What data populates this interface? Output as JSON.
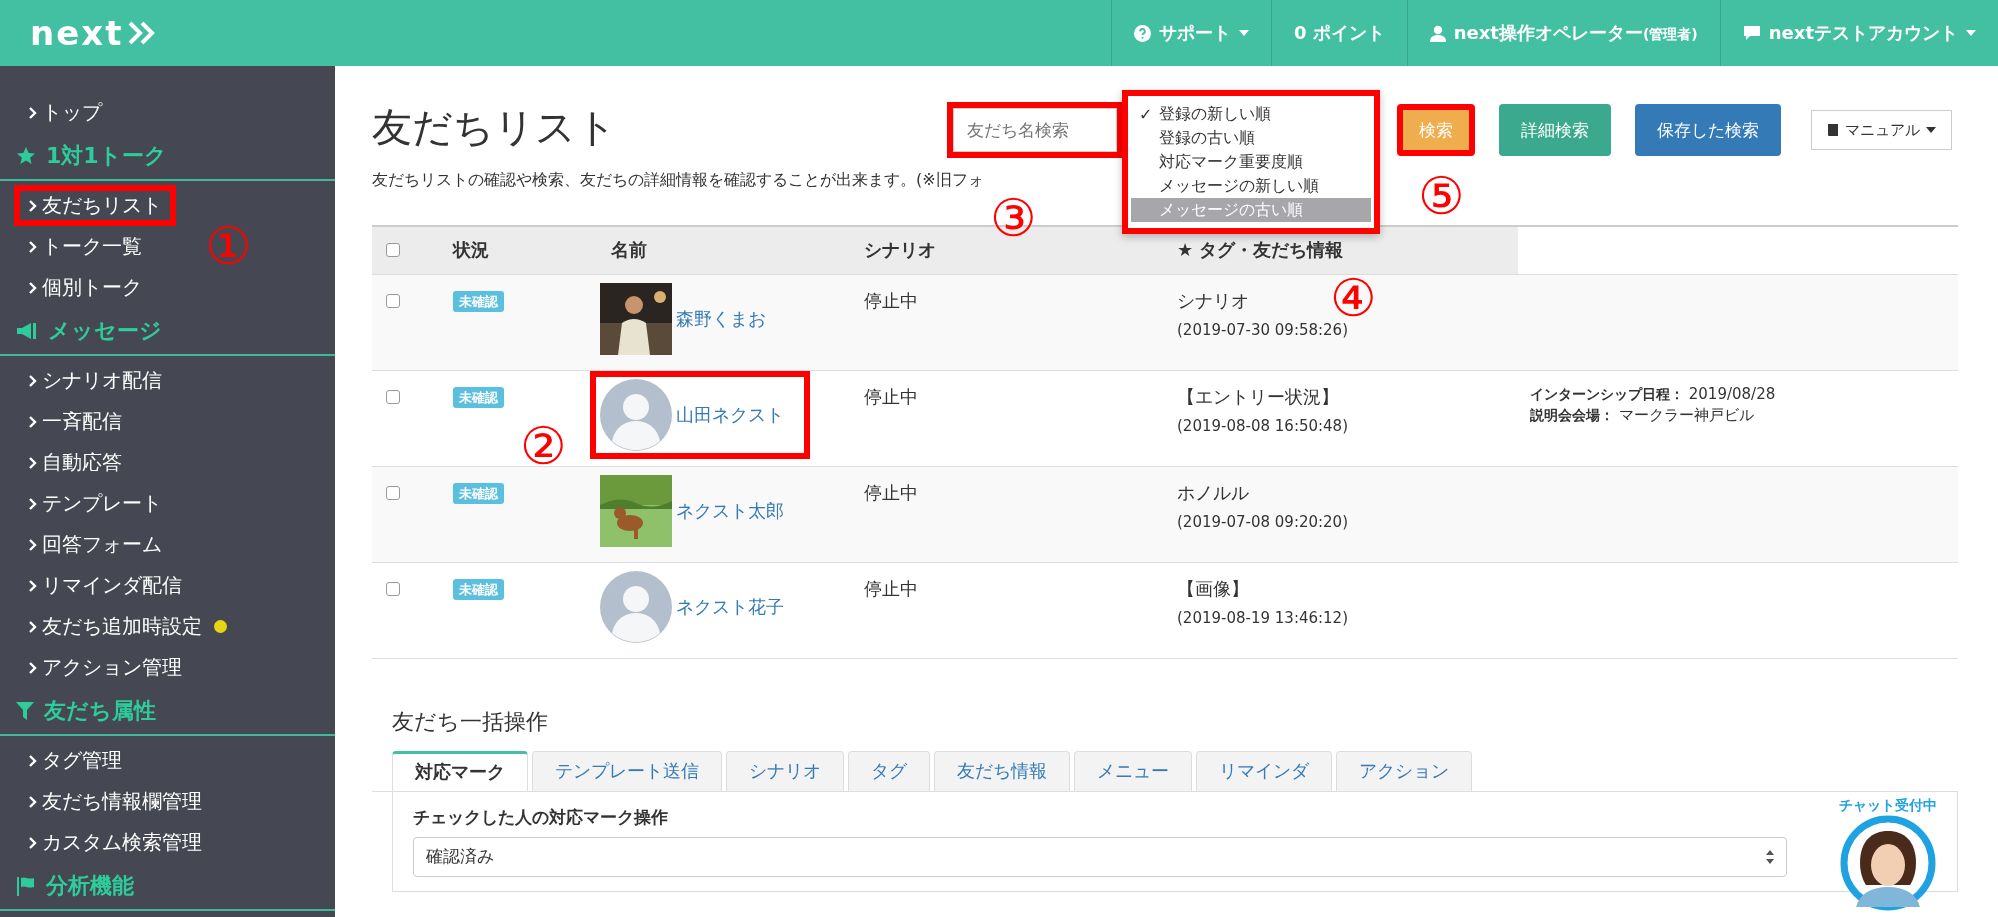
{
  "topbar": {
    "logo": "next",
    "items": [
      {
        "kind": "help",
        "label": "サポート",
        "caret": true
      },
      {
        "kind": "plain",
        "label": "0 ポイント",
        "caret": false
      },
      {
        "kind": "user",
        "label": "next操作オペレーター",
        "sub": "(管理者)",
        "caret": false
      },
      {
        "kind": "chat",
        "label": "nextテストアカウント",
        "caret": true
      }
    ]
  },
  "sidebar": [
    {
      "kind": "item",
      "label": "トップ",
      "annotated": false,
      "dot": false
    },
    {
      "kind": "header",
      "label": "1対1トーク"
    },
    {
      "kind": "item",
      "label": "友だちリスト",
      "annotated": true,
      "dot": false
    },
    {
      "kind": "item",
      "label": "トーク一覧",
      "annotated": false,
      "dot": false
    },
    {
      "kind": "item",
      "label": "個別トーク",
      "annotated": false,
      "dot": false
    },
    {
      "kind": "header",
      "label": "メッセージ"
    },
    {
      "kind": "item",
      "label": "シナリオ配信",
      "annotated": false,
      "dot": false
    },
    {
      "kind": "item",
      "label": "一斉配信",
      "annotated": false,
      "dot": false
    },
    {
      "kind": "item",
      "label": "自動応答",
      "annotated": false,
      "dot": false
    },
    {
      "kind": "item",
      "label": "テンプレート",
      "annotated": false,
      "dot": false
    },
    {
      "kind": "item",
      "label": "回答フォーム",
      "annotated": false,
      "dot": false
    },
    {
      "kind": "item",
      "label": "リマインダ配信",
      "annotated": false,
      "dot": false
    },
    {
      "kind": "item",
      "label": "友だち追加時設定",
      "annotated": false,
      "dot": true
    },
    {
      "kind": "item",
      "label": "アクション管理",
      "annotated": false,
      "dot": false
    },
    {
      "kind": "header",
      "label": "友だち属性"
    },
    {
      "kind": "item",
      "label": "タグ管理",
      "annotated": false,
      "dot": false
    },
    {
      "kind": "item",
      "label": "友だち情報欄管理",
      "annotated": false,
      "dot": false
    },
    {
      "kind": "item",
      "label": "カスタム検索管理",
      "annotated": false,
      "dot": false
    },
    {
      "kind": "header",
      "label": "分析機能"
    }
  ],
  "page": {
    "title": "友だちリスト",
    "description": "友だちリストの確認や検索、友だちの詳細情報を確認することが出来ます。(※旧フォ"
  },
  "search": {
    "placeholder": "友だち名検索",
    "annotated": true
  },
  "sort_menu": {
    "annotated": true,
    "check_mark": "✓",
    "options": [
      {
        "label": "登録の新しい順",
        "checked": true,
        "selected": false
      },
      {
        "label": "登録の古い順",
        "checked": false,
        "selected": false
      },
      {
        "label": "対応マーク重要度順",
        "checked": false,
        "selected": false
      },
      {
        "label": "メッセージの新しい順",
        "checked": false,
        "selected": false
      },
      {
        "label": "メッセージの古い順",
        "checked": false,
        "selected": true
      }
    ]
  },
  "buttons": [
    {
      "kind": "warning",
      "label": "検索",
      "annotated": true
    },
    {
      "kind": "success",
      "label": "詳細検索",
      "annotated": false
    },
    {
      "kind": "primary",
      "label": "保存した検索",
      "annotated": false
    },
    {
      "kind": "dropdown",
      "label": "マニュアル",
      "annotated": false
    }
  ],
  "table": {
    "select_all_checked": false,
    "columns": [
      "状況",
      "名前",
      "シナリオ",
      "★ タグ・友だち情報"
    ],
    "rows": [
      {
        "checked": false,
        "status": "未確認",
        "name": "森野くまお",
        "annotated": false,
        "scenario": "停止中",
        "message": "シナリオ",
        "time": "(2019-07-30 09:58:26)",
        "info": []
      },
      {
        "checked": false,
        "status": "未確認",
        "avatar": {
          "kind": "default"
        },
        "name": "山田ネクスト",
        "annotated": true,
        "scenario": "停止中",
        "message": "【エントリー状況】",
        "time": "(2019-08-08 16:50:48)",
        "info": [
          {
            "key": "インターンシップ日程：",
            "value": "2019/08/28"
          },
          {
            "key": "説明会会場：",
            "value": "マークラー神戸ビル"
          }
        ]
      },
      {
        "checked": false,
        "status": "未確認",
        "name": "ネクスト太郎",
        "annotated": false,
        "scenario": "停止中",
        "message": "ホノルル",
        "time": "(2019-07-08 09:20:20)",
        "info": []
      },
      {
        "checked": false,
        "status": "未確認",
        "avatar": {
          "kind": "default"
        },
        "name": "ネクスト花子",
        "annotated": false,
        "scenario": "停止中",
        "message": "【画像】",
        "time": "(2019-08-19 13:46:12)",
        "info": []
      }
    ]
  },
  "bulk": {
    "title": "友だち一括操作",
    "tabs": [
      {
        "label": "対応マーク",
        "selected": true
      },
      {
        "label": "テンプレート送信",
        "selected": false
      },
      {
        "label": "シナリオ",
        "selected": false
      },
      {
        "label": "タグ",
        "selected": false
      },
      {
        "label": "友だち情報",
        "selected": false
      },
      {
        "label": "メニュー",
        "selected": false
      },
      {
        "label": "リマインダ",
        "selected": false
      },
      {
        "label": "アクション",
        "selected": false
      }
    ],
    "label": "チェックした人の対応マーク操作",
    "select_value": "確認済み"
  },
  "annotations": [
    {
      "label": "①"
    },
    {
      "label": "②"
    },
    {
      "label": "③"
    },
    {
      "label": "④"
    },
    {
      "label": "⑤"
    }
  ],
  "chat_widget": {
    "label": "チャット受付中"
  }
}
